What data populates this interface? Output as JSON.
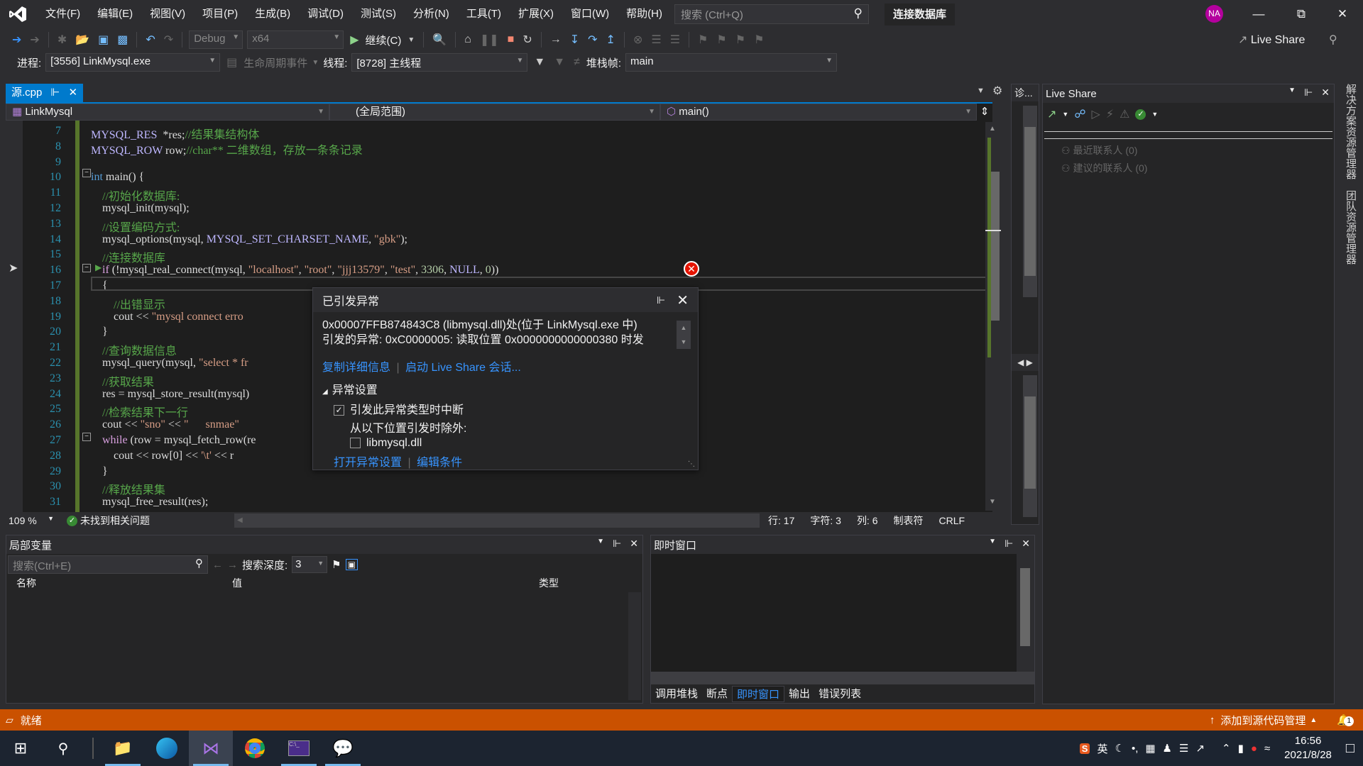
{
  "titlebar": {
    "menu": [
      "文件(F)",
      "编辑(E)",
      "视图(V)",
      "项目(P)",
      "生成(B)",
      "调试(D)",
      "测试(S)",
      "分析(N)",
      "工具(T)",
      "扩展(X)",
      "窗口(W)",
      "帮助(H)"
    ],
    "search_placeholder": "搜索 (Ctrl+Q)",
    "solution_name": "连接数据库",
    "avatar_initials": "NA",
    "avatar_color": "#b4009e"
  },
  "toolbar": {
    "config": "Debug",
    "platform": "x64",
    "continue_label": "继续(C)",
    "live_share_label": "Live Share"
  },
  "debug_location": {
    "process_label": "进程:",
    "process_value": "[3556] LinkMysql.exe",
    "lifecycle_label": "生命周期事件",
    "thread_label": "线程:",
    "thread_value": "[8728] 主线程",
    "stackframe_label": "堆栈帧:",
    "stackframe_value": "main"
  },
  "editor": {
    "tab_label": "源.cpp",
    "project_scope": "LinkMysql",
    "global_scope": "(全局范围)",
    "function_scope": "main()",
    "zoom": "109 %",
    "issues": "未找到相关问题",
    "cursor": {
      "line": "行: 17",
      "char": "字符: 3",
      "col": "列: 6",
      "indent": "制表符",
      "eol": "CRLF"
    },
    "lines": [
      {
        "n": "7",
        "segs": [
          [
            "c-mac",
            "MYSQL_RES"
          ],
          [
            "",
            "  *res;"
          ],
          [
            "c-cm",
            "//结果集结构体"
          ]
        ]
      },
      {
        "n": "8",
        "segs": [
          [
            "c-mac",
            "MYSQL_ROW"
          ],
          [
            "",
            " row;"
          ],
          [
            "c-cm",
            "//char** 二维数组，存放一条条记录"
          ]
        ]
      },
      {
        "n": "9",
        "segs": []
      },
      {
        "n": "10",
        "segs": [
          [
            "c-kw",
            "int"
          ],
          [
            "",
            " main() {"
          ]
        ]
      },
      {
        "n": "11",
        "segs": [
          [
            "",
            "    "
          ],
          [
            "c-cm",
            "//初始化数据库:"
          ]
        ]
      },
      {
        "n": "12",
        "segs": [
          [
            "",
            "    mysql_init(mysql);"
          ]
        ]
      },
      {
        "n": "13",
        "segs": [
          [
            "",
            "    "
          ],
          [
            "c-cm",
            "//设置编码方式:"
          ]
        ]
      },
      {
        "n": "14",
        "segs": [
          [
            "",
            "    mysql_options(mysql, "
          ],
          [
            "c-mac",
            "MYSQL_SET_CHARSET_NAME"
          ],
          [
            "",
            ", "
          ],
          [
            "c-str",
            "\"gbk\""
          ],
          [
            "",
            ");"
          ]
        ]
      },
      {
        "n": "15",
        "segs": [
          [
            "",
            "    "
          ],
          [
            "c-cm",
            "//连接数据库"
          ]
        ]
      },
      {
        "n": "16",
        "segs": [
          [
            "",
            "    "
          ],
          [
            "c-ctl",
            "if"
          ],
          [
            "",
            " (!mysql_real_connect(mysql, "
          ],
          [
            "c-str",
            "\"localhost\""
          ],
          [
            "",
            ", "
          ],
          [
            "c-str",
            "\"root\""
          ],
          [
            "",
            ", "
          ],
          [
            "c-str",
            "\"jjj13579\""
          ],
          [
            "",
            ", "
          ],
          [
            "c-str",
            "\"test\""
          ],
          [
            "",
            ", "
          ],
          [
            "c-num",
            "3306"
          ],
          [
            "",
            ", "
          ],
          [
            "c-mac",
            "NULL"
          ],
          [
            "",
            ", "
          ],
          [
            "c-num",
            "0"
          ],
          [
            "",
            "))"
          ]
        ]
      },
      {
        "n": "17",
        "segs": [
          [
            "",
            "    {"
          ]
        ]
      },
      {
        "n": "18",
        "segs": [
          [
            "",
            "        "
          ],
          [
            "c-cm",
            "//出错显示"
          ]
        ]
      },
      {
        "n": "19",
        "segs": [
          [
            "",
            "        cout << "
          ],
          [
            "c-str",
            "\"mysql connect erro"
          ]
        ]
      },
      {
        "n": "20",
        "segs": [
          [
            "",
            "    }"
          ]
        ]
      },
      {
        "n": "21",
        "segs": [
          [
            "",
            "    "
          ],
          [
            "c-cm",
            "//查询数据信息"
          ]
        ]
      },
      {
        "n": "22",
        "segs": [
          [
            "",
            "    mysql_query(mysql, "
          ],
          [
            "c-str",
            "\"select * fr"
          ]
        ]
      },
      {
        "n": "23",
        "segs": [
          [
            "",
            "    "
          ],
          [
            "c-cm",
            "//获取结果"
          ]
        ]
      },
      {
        "n": "24",
        "segs": [
          [
            "",
            "    res = mysql_store_result(mysql)"
          ]
        ]
      },
      {
        "n": "25",
        "segs": [
          [
            "",
            "    "
          ],
          [
            "c-cm",
            "//检索结果下一行"
          ]
        ]
      },
      {
        "n": "26",
        "segs": [
          [
            "",
            "    cout << "
          ],
          [
            "c-str",
            "\"sno\""
          ],
          [
            "",
            " << "
          ],
          [
            "c-str",
            "\"      snmae\""
          ]
        ]
      },
      {
        "n": "27",
        "segs": [
          [
            "",
            "    "
          ],
          [
            "c-ctl",
            "while"
          ],
          [
            "",
            " (row = mysql_fetch_row(re"
          ]
        ]
      },
      {
        "n": "28",
        "segs": [
          [
            "",
            "        cout << row[0] << "
          ],
          [
            "c-str",
            "'\\t'"
          ],
          [
            "",
            " << r"
          ]
        ]
      },
      {
        "n": "29",
        "segs": [
          [
            "",
            "    }"
          ]
        ]
      },
      {
        "n": "30",
        "segs": [
          [
            "",
            "    "
          ],
          [
            "c-cm",
            "//释放结果集"
          ]
        ]
      },
      {
        "n": "31",
        "segs": [
          [
            "",
            "    mysql_free_result(res);"
          ]
        ]
      }
    ]
  },
  "exception": {
    "title": "已引发异常",
    "message_line1": "0x00007FFB874843C8 (libmysql.dll)处(位于 LinkMysql.exe 中)",
    "message_line2": "引发的异常: 0xC0000005: 读取位置 0x0000000000000380 时发",
    "copy_details": "复制详细信息",
    "start_live_share": "启动 Live Share 会话...",
    "settings_header": "异常设置",
    "break_when_thrown": "引发此异常类型时中断",
    "break_when_thrown_checked": true,
    "except_when_from": "从以下位置引发时除外:",
    "except_module": "libmysql.dll",
    "except_module_checked": false,
    "open_settings": "打开异常设置",
    "edit_conditions": "编辑条件"
  },
  "locals": {
    "title": "局部变量",
    "search_placeholder": "搜索(Ctrl+E)",
    "depth_label": "搜索深度:",
    "depth_value": "3",
    "columns": [
      "名称",
      "值",
      "类型"
    ]
  },
  "immediate": {
    "title": "即时窗口",
    "tabs": [
      "调用堆栈",
      "断点",
      "即时窗口",
      "输出",
      "错误列表"
    ],
    "active_tab": "即时窗口"
  },
  "liveshare_panel": {
    "title": "Live Share",
    "contacts": [
      "最近联系人 (0)",
      "建议的联系人 (0)"
    ]
  },
  "diag_tab": "诊...",
  "right_strip": [
    "解决方案资源管理器",
    "团队资源管理器"
  ],
  "statusbar": {
    "ready": "就绪",
    "source_control": "添加到源代码管理",
    "notifications": "1",
    "color": "#ca5100"
  },
  "taskbar": {
    "ime": "英",
    "time": "16:56",
    "date": "2021/8/28"
  }
}
